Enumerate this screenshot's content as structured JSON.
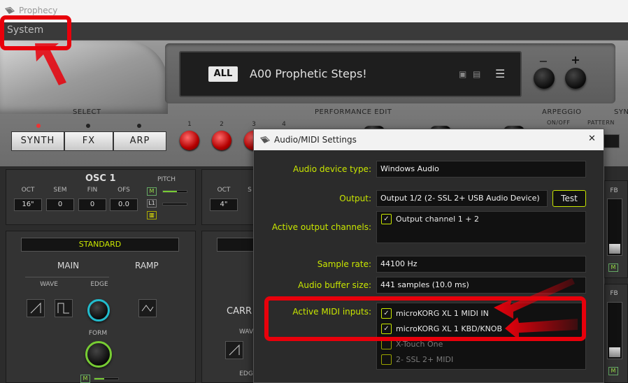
{
  "window": {
    "title": "Prophecy",
    "app_icon": "app-icon"
  },
  "menu": {
    "system": "System"
  },
  "display": {
    "bank": "ALL",
    "patch_name": "A00 Prophetic Steps!"
  },
  "labels": {
    "select": "SELECT",
    "performance_edit": "PERFORMANCE EDIT",
    "arpeggio": "ARPEGGIO",
    "syn_partial": "SYN",
    "on_off": "ON/OFF",
    "pattern": "PATTERN"
  },
  "select_buttons": [
    "SYNTH",
    "FX",
    "ARP"
  ],
  "perf_numbers": [
    "1",
    "2",
    "3",
    "4"
  ],
  "osc1": {
    "title": "OSC 1",
    "pitch": "PITCH",
    "params": [
      {
        "label": "OCT",
        "value": "16\""
      },
      {
        "label": "SEM",
        "value": "0"
      },
      {
        "label": "FIN",
        "value": "0"
      },
      {
        "label": "OFS",
        "value": "0.0"
      }
    ],
    "mode": "STANDARD",
    "main": "MAIN",
    "ramp": "RAMP",
    "wave": "WAVE",
    "edge": "EDGE",
    "form": "FORM",
    "m": "M",
    "l1": "L1"
  },
  "osc2": {
    "oct_label": "OCT",
    "sem_partial": "S",
    "oct_value": "4\"",
    "carr": "CARR",
    "wav": "WAV",
    "edg": "EDG"
  },
  "right": {
    "fb1": "FB",
    "fb2": "FB",
    "m": "M"
  },
  "dialog": {
    "title": "Audio/MIDI Settings",
    "close": "✕",
    "device_type_label": "Audio device type:",
    "device_type_value": "Windows Audio",
    "output_label": "Output:",
    "output_value": "Output 1/2 (2- SSL 2+ USB Audio Device)",
    "test": "Test",
    "active_output_label": "Active output channels:",
    "output_channel": "Output channel 1 + 2",
    "sample_rate_label": "Sample rate:",
    "sample_rate_value": "44100 Hz",
    "buffer_label": "Audio buffer size:",
    "buffer_value": "441 samples (10.0 ms)",
    "midi_label": "Active MIDI inputs:",
    "midi_inputs": [
      {
        "name": "microKORG XL 1 MIDI IN",
        "checked": true
      },
      {
        "name": "microKORG XL 1 KBD/KNOB",
        "checked": true
      },
      {
        "name": "X-Touch One",
        "checked": false
      },
      {
        "name": "2- SSL 2+ MIDI",
        "checked": false
      }
    ]
  },
  "colors": {
    "accent": "#c9e600",
    "annotation": "#e8000b",
    "led_red": "#e33"
  }
}
